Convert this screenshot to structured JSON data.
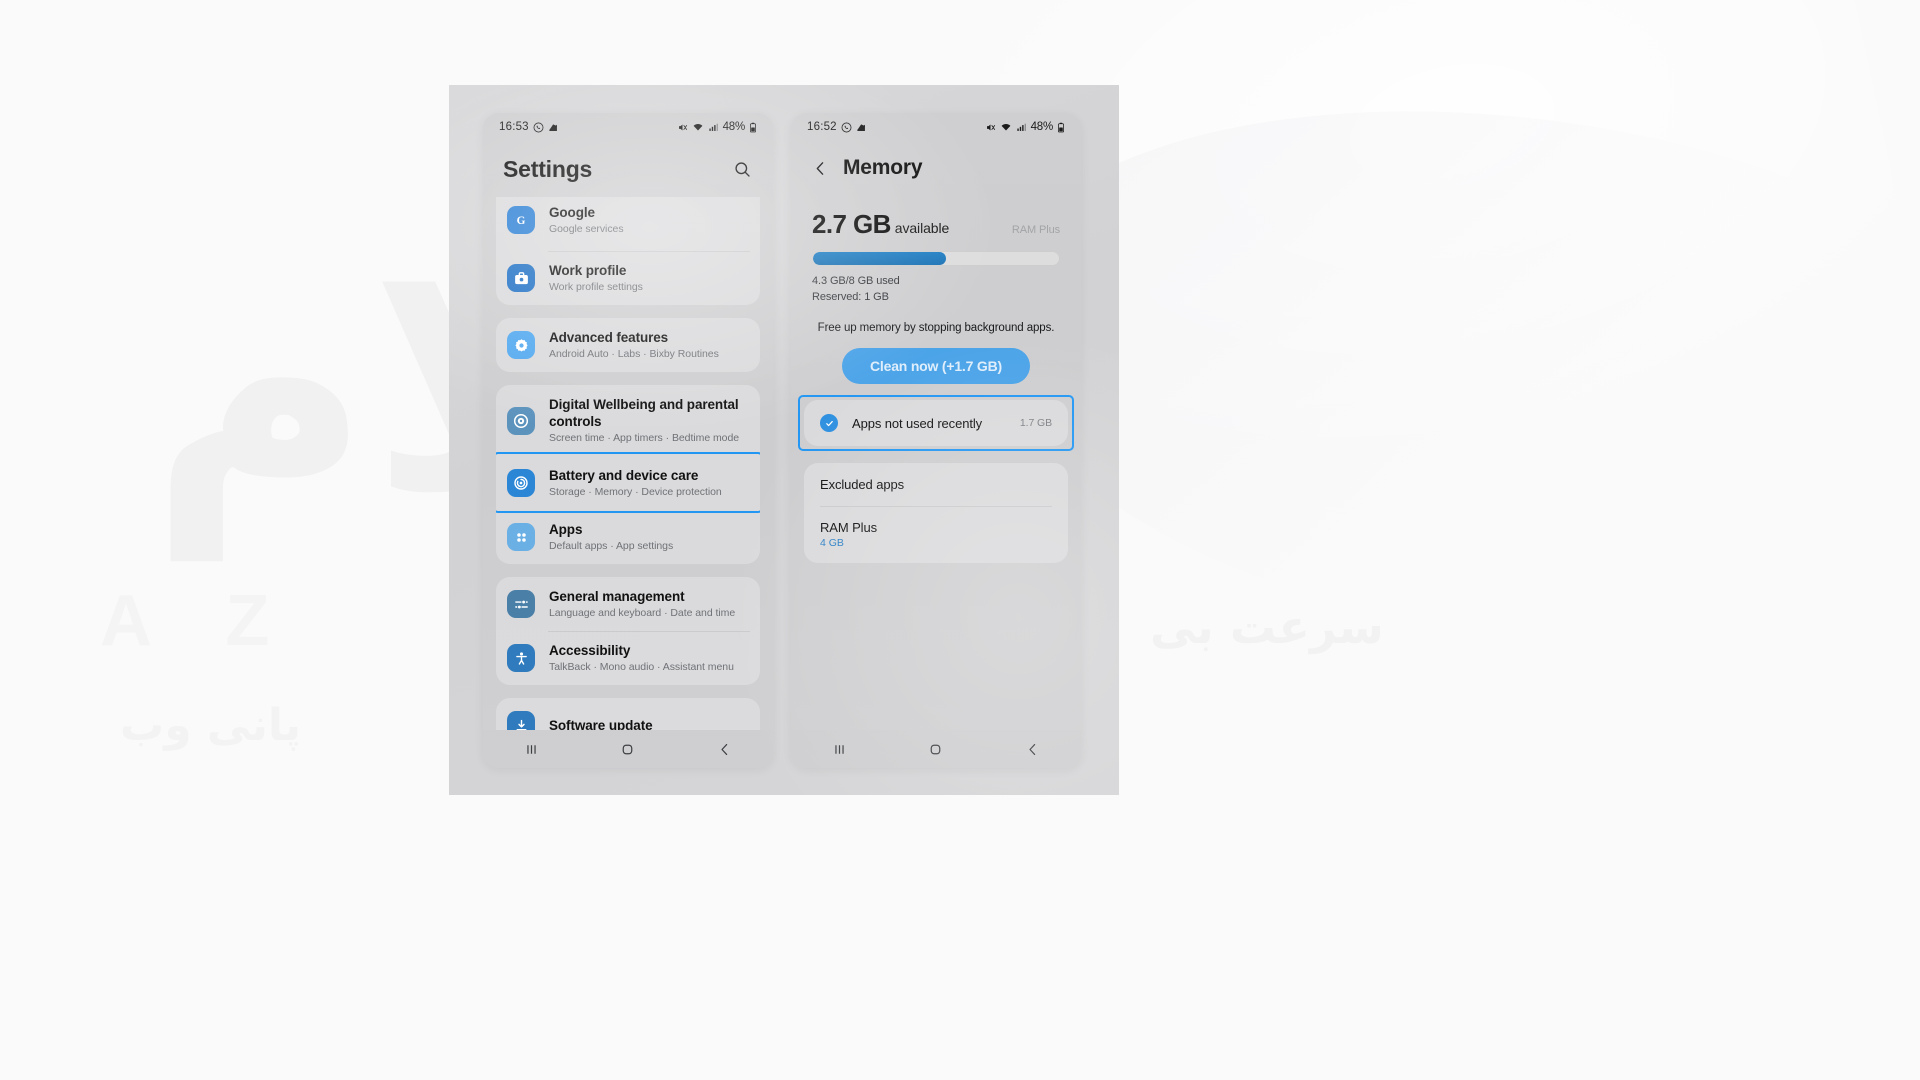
{
  "watermark": {
    "arabic": "سلام",
    "latin": "A Z",
    "persian": "پانی وب",
    "persian_right": "سرعت بی"
  },
  "colors": {
    "accent_blue": "#2196f3",
    "button_blue": "#4aa3e8",
    "bar_blue": "#1f7fc4",
    "link_blue": "#2b7fc4"
  },
  "left_phone": {
    "statusbar": {
      "time": "16:53",
      "battery_percent": "48%",
      "icons": [
        "whatsapp-icon",
        "app-notification-icon",
        "mute-icon",
        "wifi-icon",
        "signal-icon",
        "battery-icon"
      ]
    },
    "header": {
      "title": "Settings",
      "search_icon": "search-icon"
    },
    "groups": [
      {
        "id": "group-accounts",
        "clipped_top": true,
        "items": [
          {
            "title": "Google",
            "subtitle": "Google services",
            "icon": "google-icon",
            "icon_color": "#2a7fd4"
          },
          {
            "title": "Work profile",
            "subtitle": "Work profile settings",
            "icon": "work-profile-icon",
            "icon_color": "#1d6fc4"
          }
        ]
      },
      {
        "id": "group-advanced",
        "items": [
          {
            "title": "Advanced features",
            "subtitle": "Android Auto · Labs · Bixby Routines",
            "icon": "advanced-features-icon",
            "icon_color": "#51a8ef"
          }
        ]
      },
      {
        "id": "group-wellbeing-care-apps",
        "items": [
          {
            "title": "Digital Wellbeing and parental controls",
            "subtitle": "Screen time · App timers · Bedtime mode",
            "icon": "digital-wellbeing-icon",
            "icon_color": "#5c93bd"
          },
          {
            "title": "Battery and device care",
            "subtitle": "Storage · Memory · Device protection",
            "icon": "battery-device-care-icon",
            "icon_color": "#2b87d6",
            "highlighted": true
          },
          {
            "title": "Apps",
            "subtitle": "Default apps · App settings",
            "icon": "apps-icon",
            "icon_color": "#6ab0e4"
          }
        ]
      },
      {
        "id": "group-general",
        "items": [
          {
            "title": "General management",
            "subtitle": "Language and keyboard · Date and time",
            "icon": "general-management-icon",
            "icon_color": "#4a7fa8"
          },
          {
            "title": "Accessibility",
            "subtitle": "TalkBack · Mono audio · Assistant menu",
            "icon": "accessibility-icon",
            "icon_color": "#2f7bbd"
          }
        ]
      },
      {
        "id": "group-software-update",
        "clipped_bottom": true,
        "items": [
          {
            "title": "Software update",
            "subtitle": "",
            "icon": "software-update-icon",
            "icon_color": "#2f7bbd"
          }
        ]
      }
    ],
    "navbar": {
      "recents_label": "recents-button",
      "home_label": "home-button",
      "back_label": "back-button"
    }
  },
  "right_phone": {
    "statusbar": {
      "time": "16:52",
      "battery_percent": "48%",
      "icons": [
        "whatsapp-icon",
        "app-notification-icon",
        "mute-icon",
        "wifi-icon",
        "signal-icon",
        "battery-icon"
      ]
    },
    "header": {
      "back_icon": "back-arrow-icon",
      "title": "Memory"
    },
    "memory": {
      "available_value": "2.7 GB",
      "available_word": "available",
      "ram_plus_tag": "RAM Plus",
      "used_text": "4.3 GB/8 GB used",
      "reserved_text": "Reserved: 1 GB",
      "bar_percent": 54,
      "note": "Free up memory by stopping background apps.",
      "clean_button": "Clean now (+1.7 GB)"
    },
    "selection_row": {
      "label": "Apps not used recently",
      "size": "1.7 GB",
      "checked": true,
      "highlighted": true
    },
    "bottom_card": [
      {
        "label": "Excluded apps",
        "sub": ""
      },
      {
        "label": "RAM Plus",
        "sub": "4 GB"
      }
    ],
    "navbar": {
      "recents_label": "recents-button",
      "home_label": "home-button",
      "back_label": "back-button"
    }
  }
}
